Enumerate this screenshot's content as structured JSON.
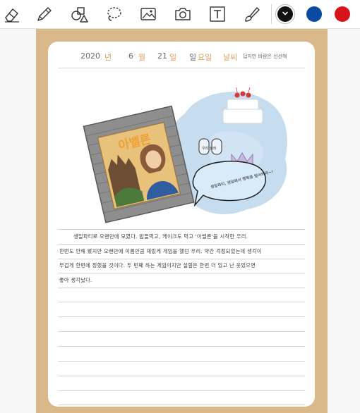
{
  "toolbar": {
    "tools": [
      {
        "name": "eraser-tool",
        "icon": "eraser-icon"
      },
      {
        "name": "pen-tool",
        "icon": "pencil-icon"
      },
      {
        "name": "shapes-tool",
        "icon": "shapes-icon"
      },
      {
        "name": "lasso-tool",
        "icon": "lasso-icon"
      },
      {
        "name": "image-tool",
        "icon": "image-icon"
      },
      {
        "name": "camera-tool",
        "icon": "camera-icon"
      },
      {
        "name": "text-tool",
        "icon": "text-box-icon"
      },
      {
        "name": "marker-tool",
        "icon": "brush-icon"
      }
    ],
    "colors": [
      {
        "name": "black",
        "hex": "#111111",
        "selected": true
      },
      {
        "name": "blue",
        "hex": "#0a4aa0",
        "selected": false
      },
      {
        "name": "red",
        "hex": "#d7141a",
        "selected": false
      }
    ]
  },
  "date": {
    "year": "2020",
    "year_unit": "년",
    "month": "6",
    "month_unit": "월",
    "day": "21",
    "day_unit": "일",
    "weekday": "일",
    "weekday_unit": "요일",
    "weather_label": "날씨",
    "weather_value": "덥지만 바람은 선선해"
  },
  "illustration": {
    "book_title": "아벨른",
    "speech_bubble": "생일파티, 생일에서 행복을 빌어봐라~!",
    "badge": "우리 설레"
  },
  "diary": {
    "lines": [
      "생일파티로 오랜만에 모였다. 밥들먹고, 케이크도 먹고 '아벨른'을 시작한 우리.",
      "한번도 안해 봤지만 오랜만에 이름만큼 재밌게 게임을 했던 우리. 약간 걱정되었는데 생각이",
      "무겁게 한번에 정했을 것이다. 두 번째 하는 게임이지만 설렘은 한번 더 있고 난 웃었으면",
      "좋아 생각났다."
    ]
  }
}
